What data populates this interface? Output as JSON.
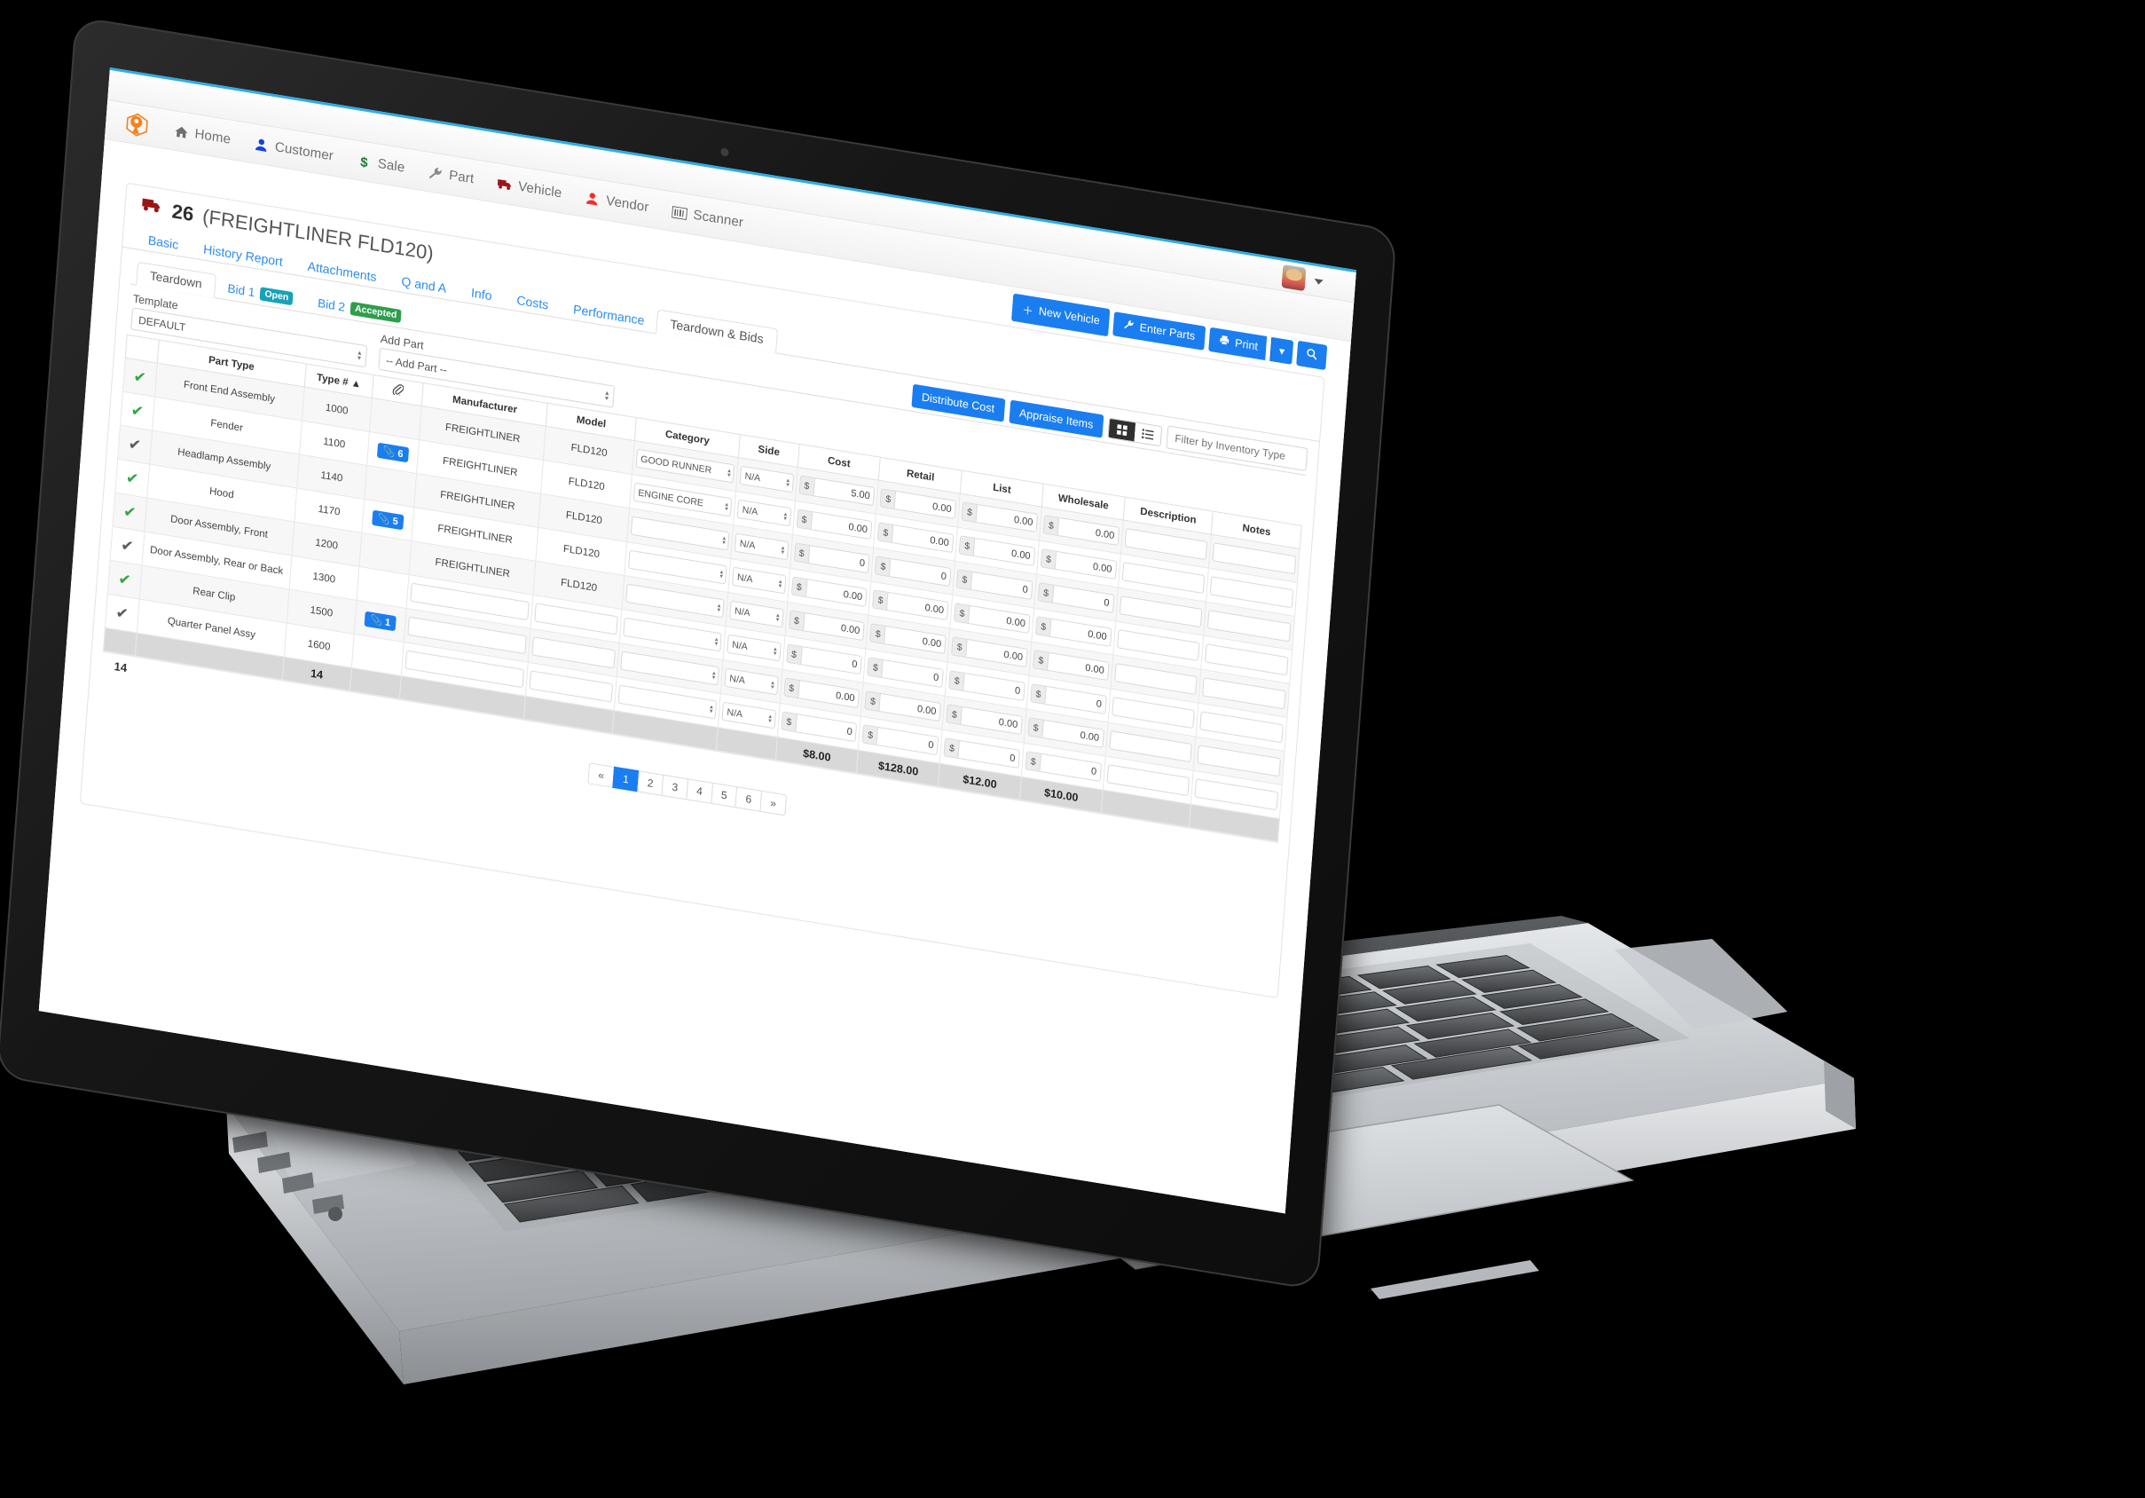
{
  "app": {
    "brand_color": "#f5821f",
    "accent": "#1a7ef0"
  },
  "topbar": {
    "avatar_alt": "user-avatar",
    "caret": "▾"
  },
  "nav": {
    "items": [
      {
        "label": "Home",
        "icon": "home-icon",
        "color": "#6f6f6f"
      },
      {
        "label": "Customer",
        "icon": "person-icon",
        "color": "#1a3fe0"
      },
      {
        "label": "Sale",
        "icon": "dollar-icon",
        "color": "#1c7a35"
      },
      {
        "label": "Part",
        "icon": "wrench-icon",
        "color": "#8b8b8b"
      },
      {
        "label": "Vehicle",
        "icon": "truck-icon",
        "color": "#9b1616"
      },
      {
        "label": "Vendor",
        "icon": "person-icon",
        "color": "#f03030"
      },
      {
        "label": "Scanner",
        "icon": "barcode-icon",
        "color": "#555555"
      }
    ]
  },
  "actions": {
    "new_vehicle": "New Vehicle",
    "enter_parts": "Enter Parts",
    "print": "Print",
    "print_caret": "▾",
    "search_icon": "search-icon"
  },
  "vehicle": {
    "icon": "truck-icon",
    "number": "26",
    "model": "(FREIGHTLINER FLD120)"
  },
  "tabs": [
    {
      "label": "Basic",
      "active": false
    },
    {
      "label": "History Report",
      "active": false
    },
    {
      "label": "Attachments",
      "active": false
    },
    {
      "label": "Q and A",
      "active": false
    },
    {
      "label": "Info",
      "active": false
    },
    {
      "label": "Costs",
      "active": false
    },
    {
      "label": "Performance",
      "active": false
    },
    {
      "label": "Teardown & Bids",
      "active": true
    }
  ],
  "subtabs": [
    {
      "label": "Teardown",
      "badge": null,
      "badge_kind": null,
      "active": true
    },
    {
      "label": "Bid 1",
      "badge": "Open",
      "badge_kind": "open",
      "active": false
    },
    {
      "label": "Bid 2",
      "badge": "Accepted",
      "badge_kind": "accepted",
      "active": false
    }
  ],
  "toolbar": {
    "distribute_cost": "Distribute Cost",
    "appraise_items": "Appraise Items",
    "grid_view_icon": "grid-view-icon",
    "list_view_icon": "list-view-icon",
    "filter_placeholder": "Filter by Inventory Type"
  },
  "form": {
    "template_label": "Template",
    "template_value": "DEFAULT",
    "add_part_label": "Add Part",
    "add_part_value": "-- Add Part --",
    "select_arrows": "▴▾"
  },
  "table": {
    "columns": [
      "",
      "Part Type",
      "Type # ▲",
      "paperclip-icon",
      "Manufacturer",
      "Model",
      "Category",
      "Side",
      "Cost",
      "Retail",
      "List",
      "Wholesale",
      "Description",
      "Notes"
    ],
    "rows": [
      {
        "checked": true,
        "check_color": "green",
        "part_type": "Front End Assembly",
        "type_no": "1000",
        "clips": null,
        "manufacturer": "FREIGHTLINER",
        "model": "FLD120",
        "category": "GOOD RUNNER",
        "side": "N/A",
        "cost": "5.00",
        "retail": "0.00",
        "list": "0.00",
        "wholesale": "0.00",
        "description": "",
        "notes": ""
      },
      {
        "checked": true,
        "check_color": "green",
        "part_type": "Fender",
        "type_no": "1100",
        "clips": "6",
        "manufacturer": "FREIGHTLINER",
        "model": "FLD120",
        "category": "ENGINE CORE",
        "side": "N/A",
        "cost": "0.00",
        "retail": "0.00",
        "list": "0.00",
        "wholesale": "0.00",
        "description": "",
        "notes": ""
      },
      {
        "checked": true,
        "check_color": "grey",
        "part_type": "Headlamp Assembly",
        "type_no": "1140",
        "clips": null,
        "manufacturer": "FREIGHTLINER",
        "model": "FLD120",
        "category": "",
        "side": "N/A",
        "cost": "0",
        "retail": "0",
        "list": "0",
        "wholesale": "0",
        "description": "",
        "notes": ""
      },
      {
        "checked": true,
        "check_color": "green",
        "part_type": "Hood",
        "type_no": "1170",
        "clips": "5",
        "manufacturer": "FREIGHTLINER",
        "model": "FLD120",
        "category": "",
        "side": "N/A",
        "cost": "0.00",
        "retail": "0.00",
        "list": "0.00",
        "wholesale": "0.00",
        "description": "",
        "notes": ""
      },
      {
        "checked": true,
        "check_color": "green",
        "part_type": "Door Assembly, Front",
        "type_no": "1200",
        "clips": null,
        "manufacturer": "FREIGHTLINER",
        "model": "FLD120",
        "category": "",
        "side": "N/A",
        "cost": "0.00",
        "retail": "0.00",
        "list": "0.00",
        "wholesale": "0.00",
        "description": "",
        "notes": ""
      },
      {
        "checked": true,
        "check_color": "grey",
        "part_type": "Door Assembly, Rear or Back",
        "type_no": "1300",
        "clips": null,
        "manufacturer": "",
        "model": "",
        "category": "",
        "side": "N/A",
        "cost": "0",
        "retail": "0",
        "list": "0",
        "wholesale": "0",
        "description": "",
        "notes": ""
      },
      {
        "checked": true,
        "check_color": "green",
        "part_type": "Rear Clip",
        "type_no": "1500",
        "clips": "1",
        "manufacturer": "",
        "model": "",
        "category": "",
        "side": "N/A",
        "cost": "0.00",
        "retail": "0.00",
        "list": "0.00",
        "wholesale": "0.00",
        "description": "",
        "notes": ""
      },
      {
        "checked": true,
        "check_color": "grey",
        "part_type": "Quarter Panel Assy",
        "type_no": "1600",
        "clips": null,
        "manufacturer": "",
        "model": "",
        "category": "",
        "side": "N/A",
        "cost": "0",
        "retail": "0",
        "list": "0",
        "wholesale": "0",
        "description": "",
        "notes": ""
      }
    ],
    "totals": {
      "count": "14",
      "cost": "$8.00",
      "retail": "$128.00",
      "list": "$12.00",
      "wholesale": "$10.00"
    },
    "footer_count": "14"
  },
  "pagination": {
    "first": "«",
    "pages": [
      "1",
      "2",
      "3",
      "4",
      "5",
      "6"
    ],
    "active": "1",
    "last": "»"
  }
}
